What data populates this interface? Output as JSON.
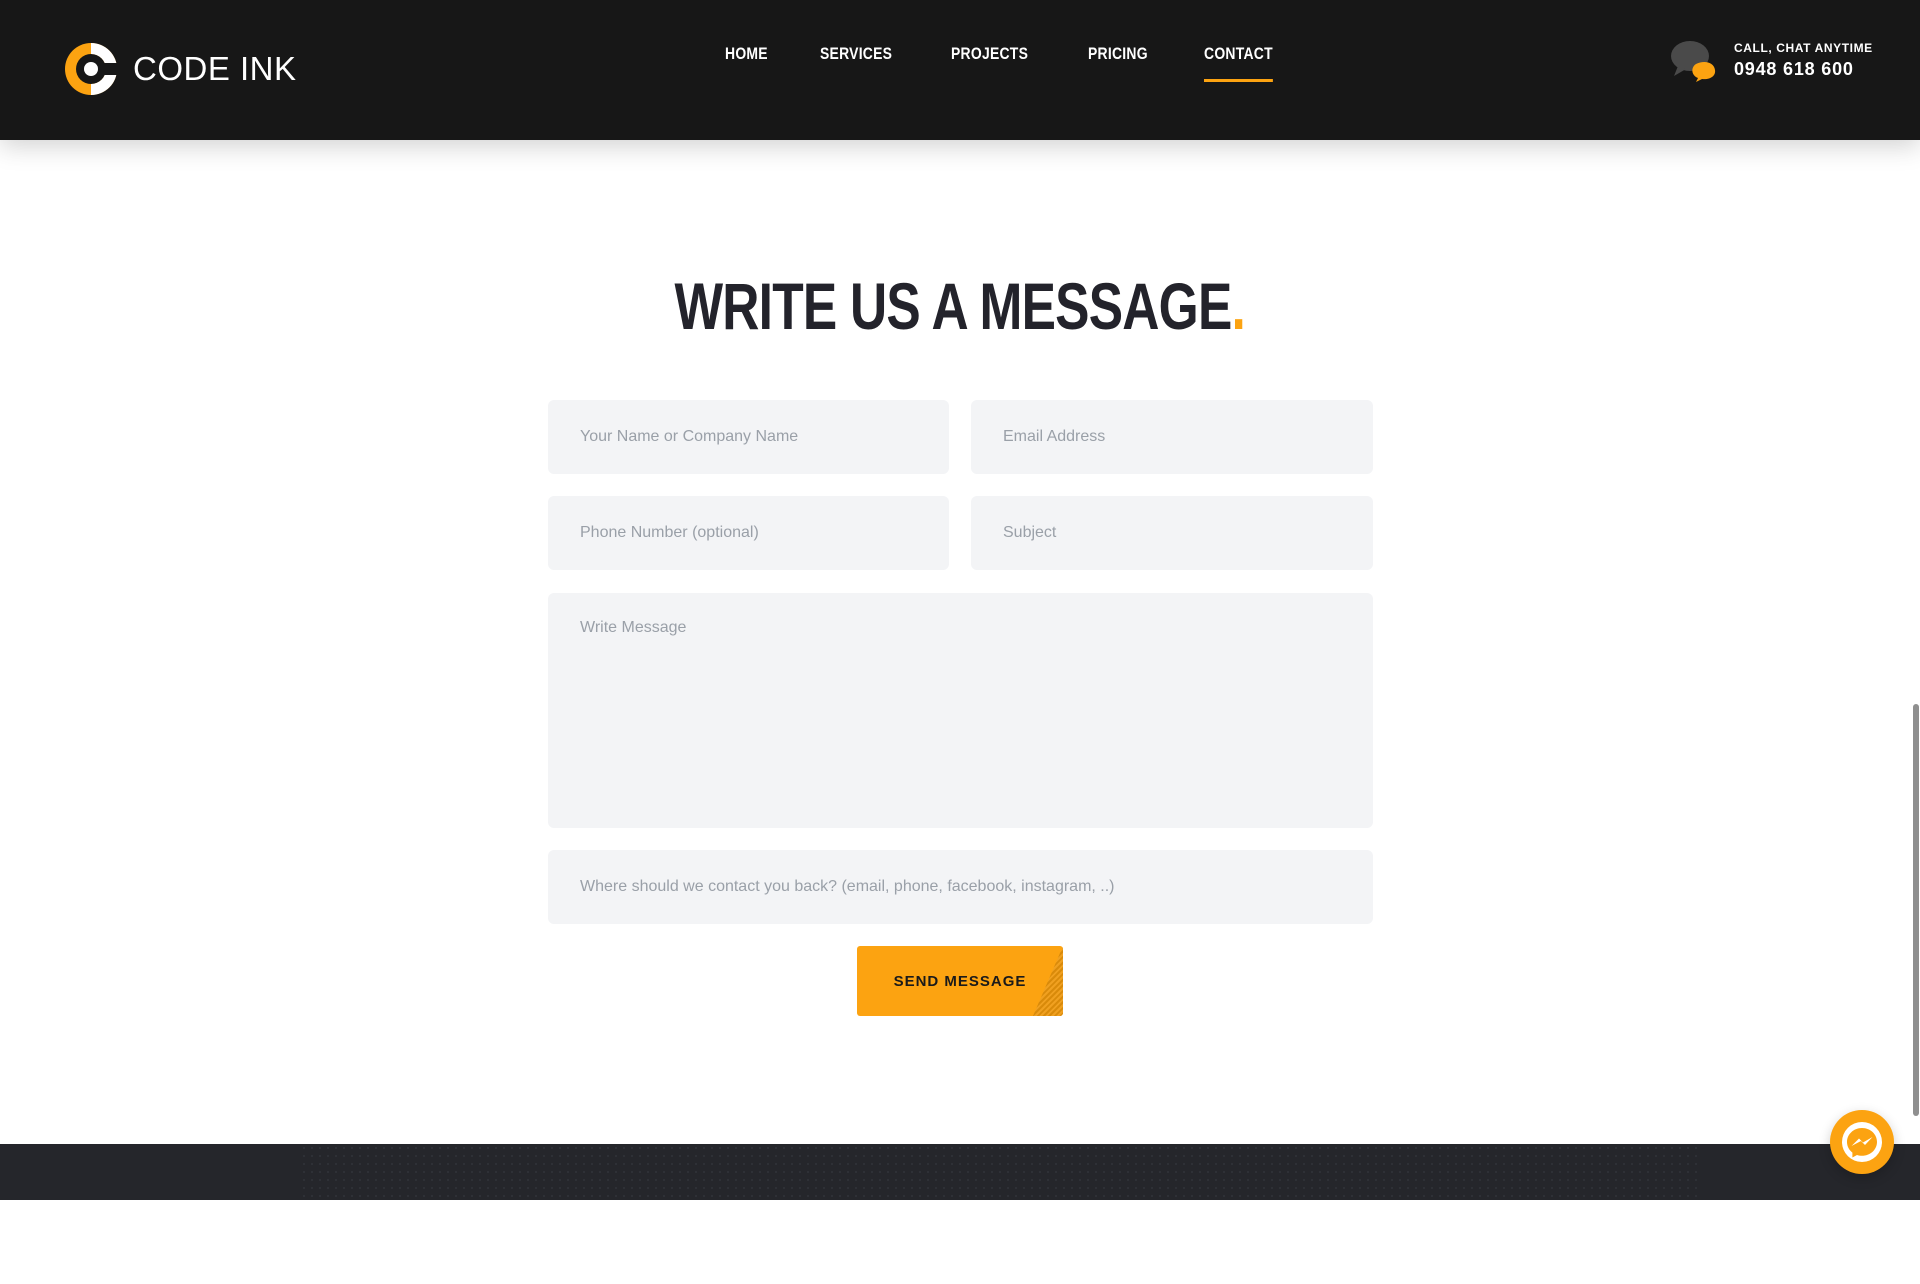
{
  "brand": {
    "name": "CODE INK",
    "accent_color": "#fca311",
    "header_bg": "#171717"
  },
  "nav": {
    "items": [
      {
        "label": "HOME"
      },
      {
        "label": "SERVICES"
      },
      {
        "label": "PROJECTS"
      },
      {
        "label": "PRICING"
      },
      {
        "label": "CONTACT",
        "active": true
      }
    ]
  },
  "contact": {
    "label": "CALL, CHAT ANYTIME",
    "phone": "0948 618 600",
    "icon": "chat-bubbles-icon"
  },
  "form": {
    "title": "WRITE US A MESSAGE",
    "title_dot": ".",
    "fields": {
      "name": {
        "placeholder": "Your Name or Company Name",
        "value": ""
      },
      "email": {
        "placeholder": "Email Address",
        "value": ""
      },
      "phone": {
        "placeholder": "Phone Number (optional)",
        "value": ""
      },
      "subject": {
        "placeholder": "Subject",
        "value": ""
      },
      "message": {
        "placeholder": "Write Message",
        "value": ""
      },
      "contact_back": {
        "placeholder": "Where should we contact you back? (email, phone, facebook, instagram, ..)",
        "value": ""
      }
    },
    "submit_label": "SEND MESSAGE"
  },
  "widgets": {
    "messenger_icon": "messenger-icon"
  }
}
